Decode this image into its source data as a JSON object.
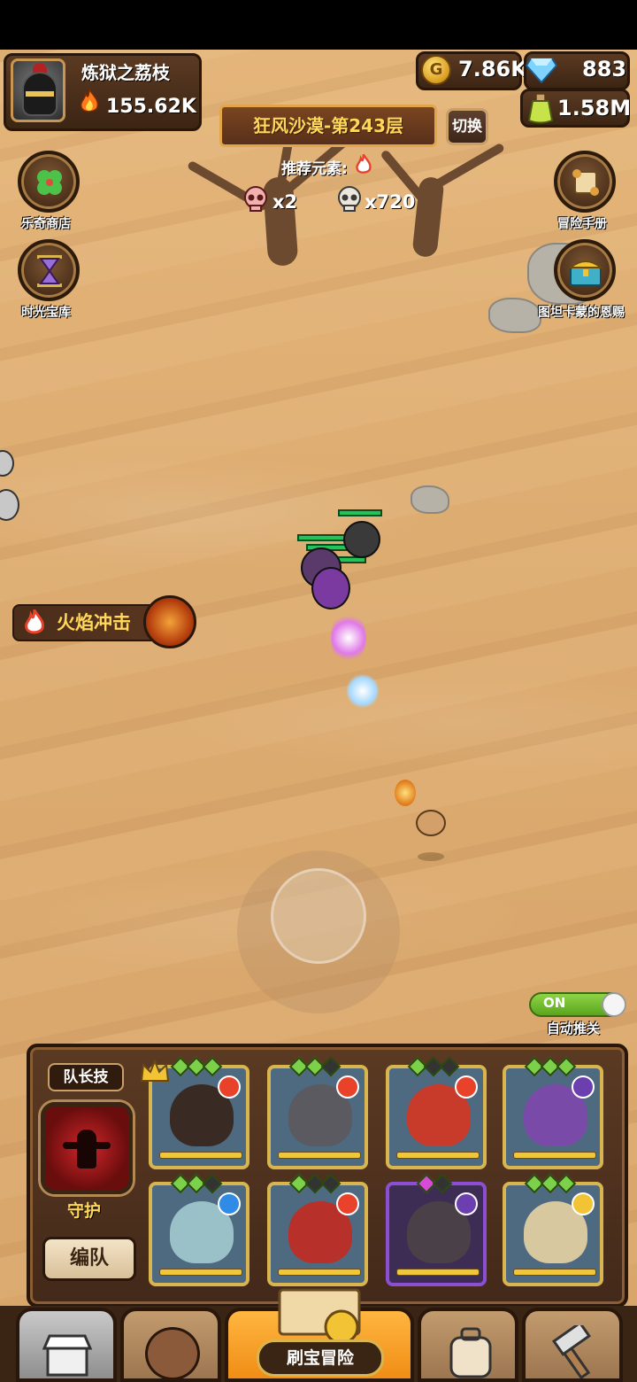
{
  "player": {
    "name": "炼狱之荔枝",
    "power": "155.62K"
  },
  "resources": {
    "gold": "7.86K",
    "gems": "883",
    "potion": "1.58M",
    "coin_symbol": "G"
  },
  "stage": {
    "title": "狂风沙漠-第243层",
    "switch_label": "切换",
    "recommend_label": "推荐元素:"
  },
  "enemy_counts": {
    "elite": "x2",
    "normal": "x720"
  },
  "left_menu": [
    {
      "label": "乐奇商店",
      "icon": "clover-icon"
    },
    {
      "label": "时光宝库",
      "icon": "hourglass-icon"
    }
  ],
  "right_menu": [
    {
      "label": "冒险手册",
      "icon": "scroll-icon"
    },
    {
      "label": "图坦卡蒙的恩赐",
      "icon": "treasure-chest-icon"
    }
  ],
  "skill_popup": {
    "label": "火焰冲击"
  },
  "auto_advance": {
    "state": "ON",
    "label": "自动推关"
  },
  "team": {
    "leader_tag": "队长技",
    "leader_skill_name": "守护",
    "edit_label": "编队",
    "heroes": [
      {
        "element": "fire",
        "rarity": "gold"
      },
      {
        "element": "fire",
        "rarity": "gold"
      },
      {
        "element": "fire",
        "rarity": "gold"
      },
      {
        "element": "dark",
        "rarity": "gold"
      },
      {
        "element": "water",
        "rarity": "gold"
      },
      {
        "element": "fire",
        "rarity": "gold"
      },
      {
        "element": "dark",
        "rarity": "purple"
      },
      {
        "element": "light",
        "rarity": "gold"
      }
    ]
  },
  "bottom_nav": {
    "active_label": "刷宝冒险"
  },
  "colors": {
    "fire": "#e8432a",
    "dark": "#6b3fb0",
    "water": "#2f8be6",
    "light": "#f2c334",
    "gold_text": "#ffd75a"
  }
}
